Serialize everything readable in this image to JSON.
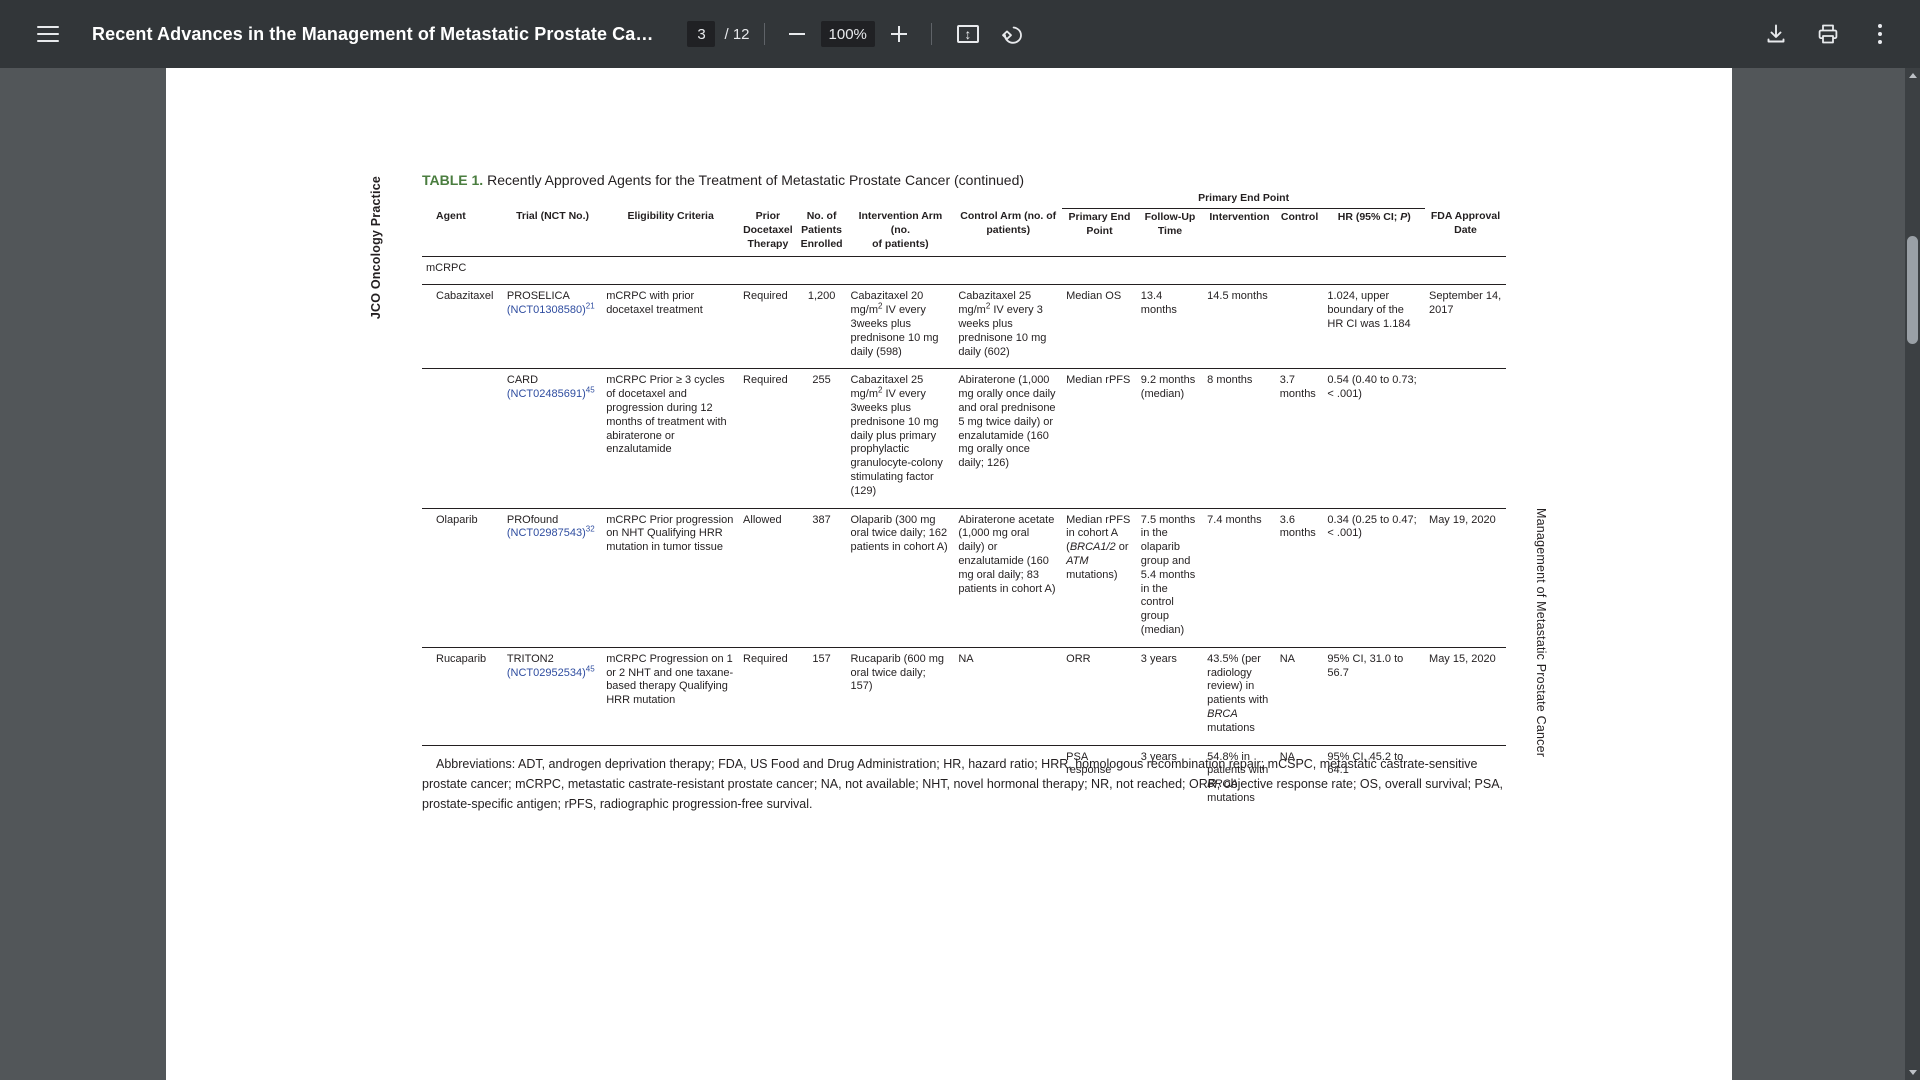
{
  "toolbar": {
    "menu_icon": "hamburger-menu-icon",
    "title": "Recent Advances in the Management of Metastatic Prostate Ca…",
    "page_number": "3",
    "page_total": "/ 12",
    "zoom_out_icon": "minus-icon",
    "zoom_level": "100%",
    "zoom_in_icon": "plus-icon",
    "fit_icon": "fit-to-page-icon",
    "rotate_icon": "rotate-counterclockwise-icon",
    "download_icon": "download-icon",
    "print_icon": "print-icon",
    "more_icon": "more-vertical-icon"
  },
  "scrollbar": {
    "up_arrow": "scroll-up-arrow",
    "down_arrow": "scroll-down-arrow"
  },
  "document": {
    "side_label_left": "JCO Oncology Practice",
    "side_label_right": "Management of Metastatic Prostate Cancer",
    "table_label": "TABLE 1.",
    "table_caption": "Recently Approved Agents for the Treatment of Metastatic Prostate Cancer (continued)",
    "group_header": "Primary End Point",
    "headers": {
      "agent": "Agent",
      "trial": "Trial (NCT No.)",
      "eligibility": "Eligibility Criteria",
      "prior_docetaxel": "Prior\nDocetaxel\nTherapy",
      "no_patients": "No. of\nPatients\nEnrolled",
      "intervention_arm": "Intervention Arm (no.\nof patients)",
      "control_arm": "Control Arm (no. of\npatients)",
      "primary_end_point": "Primary End\nPoint",
      "follow_up": "Follow-Up\nTime",
      "intervention": "Intervention",
      "control": "Control",
      "hr": "HR (95% CI; P)",
      "fda_date": "FDA Approval\nDate"
    },
    "section_row": "mCRPC",
    "rows": [
      {
        "agent": "Cabazitaxel",
        "trial_name": "PROSELICA",
        "trial_nct": "(NCT01308580)",
        "trial_ref": "21",
        "eligibility": "mCRPC with prior docetaxel treatment",
        "prior_docetaxel": "Required",
        "no_patients": "1,200",
        "intervention_arm": "Cabazitaxel 20 mg/m2 IV every 3weeks plus prednisone 10 mg daily (598)",
        "control_arm": "Cabazitaxel 25 mg/m2 IV every 3 weeks plus prednisone 10 mg daily (602)",
        "primary_end_point": "Median OS",
        "follow_up": "13.4 months",
        "intervention": "14.5 months",
        "control": "",
        "hr": "1.024, upper boundary of the HR CI was 1.184",
        "fda_date": "September 14, 2017"
      },
      {
        "agent": "",
        "trial_name": "CARD",
        "trial_nct": "(NCT02485691)",
        "trial_ref": "45",
        "eligibility": "mCRPC Prior ≥ 3 cycles of docetaxel and progression during 12 months of treatment with abiraterone or enzalutamide",
        "prior_docetaxel": "Required",
        "no_patients": "255",
        "intervention_arm": "Cabazitaxel 25 mg/m2 IV every 3weeks plus prednisone 10 mg daily plus primary prophylactic granulocyte-colony stimulating factor (129)",
        "control_arm": "Abiraterone (1,000 mg orally once daily and oral prednisone 5 mg twice daily) or enzalutamide (160 mg orally once daily; 126)",
        "primary_end_point": "Median rPFS",
        "follow_up": "9.2 months (median)",
        "intervention": "8 months",
        "control": "3.7 months",
        "hr": "0.54 (0.40 to 0.73; < .001)",
        "fda_date": ""
      },
      {
        "agent": "Olaparib",
        "trial_name": "PROfound",
        "trial_nct": "(NCT02987543)",
        "trial_ref": "32",
        "eligibility": "mCRPC Prior progression on NHT Qualifying HRR mutation in tumor tissue",
        "prior_docetaxel": "Allowed",
        "no_patients": "387",
        "intervention_arm": "Olaparib (300 mg oral twice daily; 162 patients in cohort A)",
        "control_arm": "Abiraterone acetate (1,000 mg oral daily) or enzalutamide (160 mg oral daily; 83 patients in cohort A)",
        "primary_end_point": "Median rPFS in cohort A (BRCA1/2 or ATM mutations)",
        "follow_up": "7.5 months in the olaparib group and 5.4 months in the control group (median)",
        "intervention": "7.4 months",
        "control": "3.6 months",
        "hr": "0.34 (0.25 to 0.47; < .001)",
        "fda_date": "May 19, 2020"
      },
      {
        "agent": "Rucaparib",
        "trial_name": "TRITON2",
        "trial_nct": "(NCT02952534)",
        "trial_ref": "45",
        "eligibility": "mCRPC Progression on 1 or 2 NHT and one taxane-based therapy Qualifying HRR mutation",
        "prior_docetaxel": "Required",
        "no_patients": "157",
        "intervention_arm": "Rucaparib (600 mg oral twice daily; 157)",
        "control_arm": "NA",
        "primary_end_point": "ORR",
        "follow_up": "3 years",
        "intervention": "43.5% (per radiology review) in patients with BRCA mutations",
        "control": "NA",
        "hr": "95% CI, 31.0 to 56.7",
        "fda_date": "May 15, 2020"
      },
      {
        "agent": "",
        "trial_name": "",
        "trial_nct": "",
        "trial_ref": "",
        "eligibility": "",
        "prior_docetaxel": "",
        "no_patients": "",
        "intervention_arm": "",
        "control_arm": "",
        "primary_end_point": "PSA response",
        "follow_up": "3 years",
        "intervention": "54.8% in patients with BRCA mutations",
        "control": "NA",
        "hr": "95% CI, 45.2 to 64.1",
        "fda_date": ""
      }
    ],
    "abbreviations": "Abbreviations: ADT, androgen deprivation therapy; FDA, US Food and Drug Administration; HR, hazard ratio; HRR, homologous recombination repair; mCSPC, metastatic castrate-sensitive prostate cancer; mCRPC, metastatic castrate-resistant prostate cancer; NA, not available; NHT, novel hormonal therapy; NR, not reached; ORR, objective response rate; OS, overall survival; PSA, prostate-specific antigen; rPFS, radiographic progression-free survival."
  },
  "colors": {
    "toolbar_bg": "#323639",
    "viewer_bg": "#525659",
    "page_bg": "#ffffff",
    "table_label_green": "#4a7d3f",
    "link_blue": "#2f4da0",
    "scrollbar_thumb": "#9aa0a6"
  }
}
